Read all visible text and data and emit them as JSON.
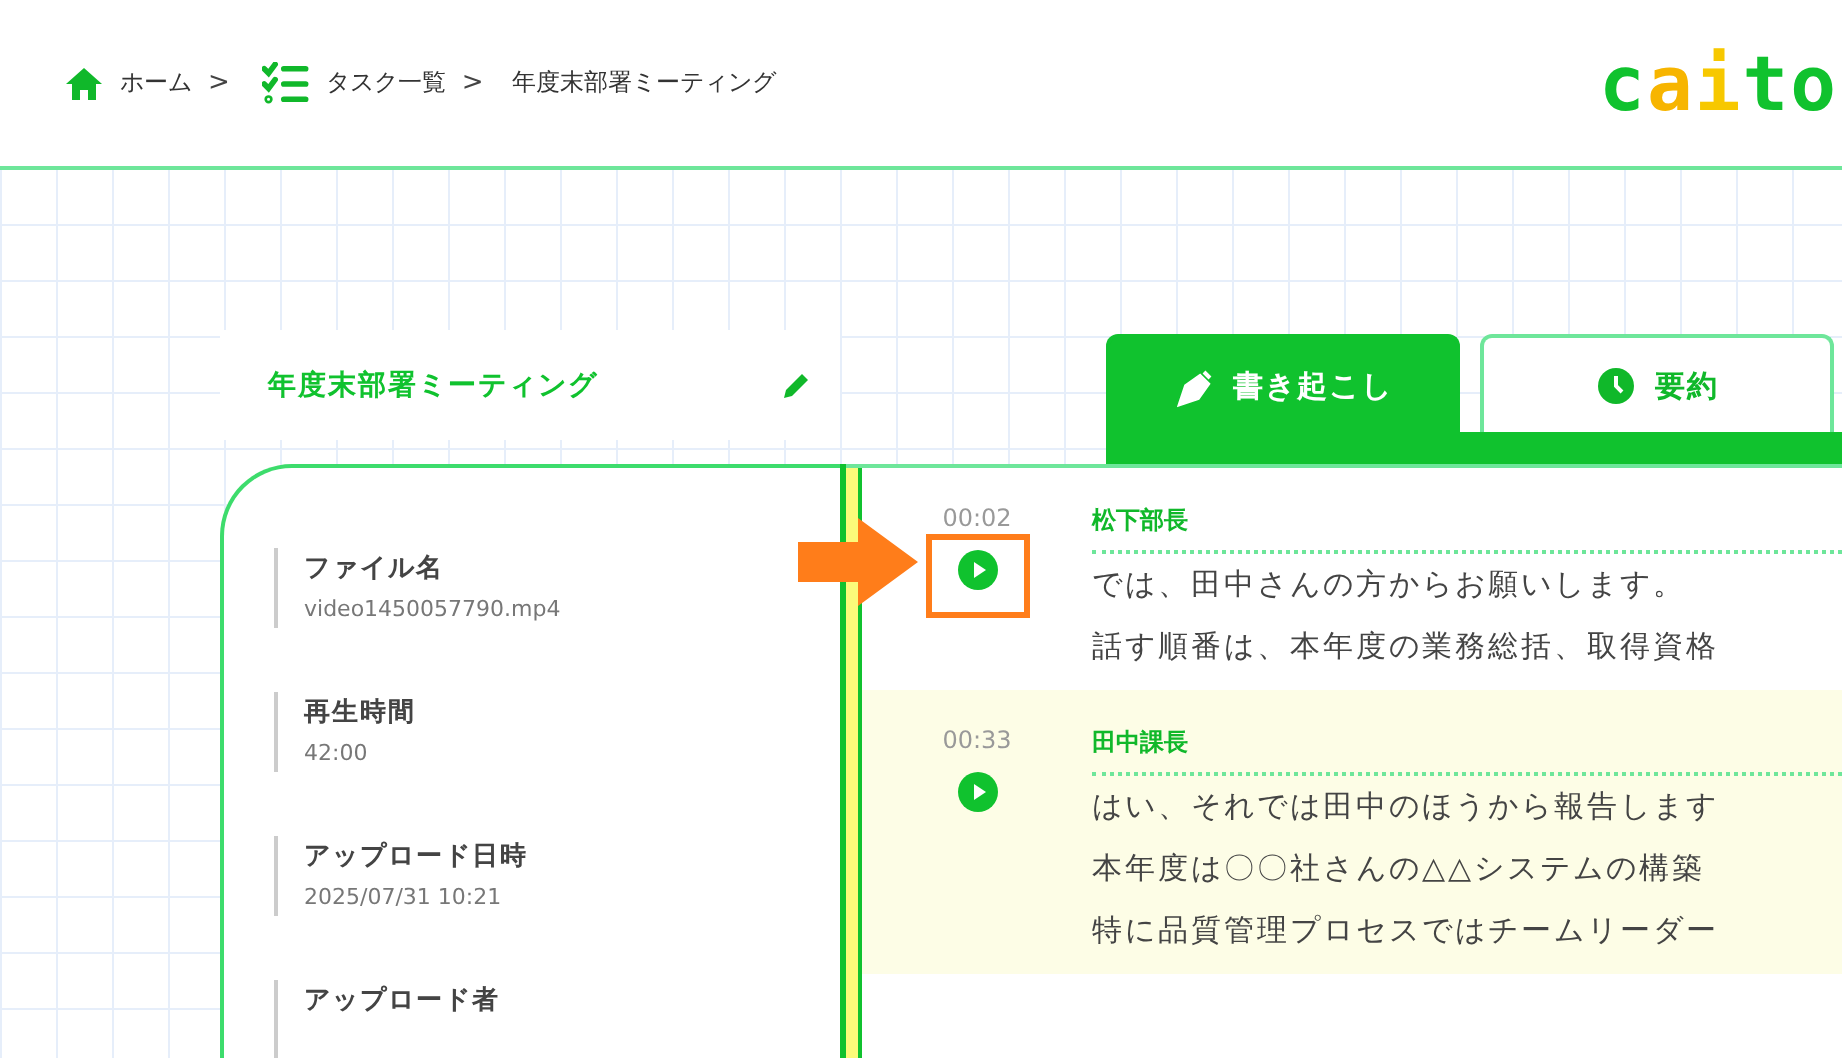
{
  "breadcrumbs": [
    {
      "label": "ホーム",
      "separator": ">"
    },
    {
      "label": "タスク一覧",
      "separator": ">"
    },
    {
      "label": "年度末部署ミーティング"
    }
  ],
  "logo": "caito",
  "title": "年度末部署ミーティング",
  "tabs": [
    {
      "label": "書き起こし",
      "selected": true
    },
    {
      "label": "要約",
      "selected": false
    }
  ],
  "file_info": [
    {
      "label": "ファイル名",
      "value": "video1450057790.mp4"
    },
    {
      "label": "再生時間",
      "value": "42:00"
    },
    {
      "label": "アップロード日時",
      "value": "2025/07/31 10:21"
    },
    {
      "label": "アップロード者"
    }
  ],
  "transcript": [
    {
      "time": "00:02",
      "speaker": "松下部長",
      "highlighted": false,
      "pointed": true,
      "lines": [
        "では、田中さんの方からお願いします。",
        "話す順番は、本年度の業務総括、取得資格"
      ]
    },
    {
      "time": "00:33",
      "speaker": "田中課長",
      "highlighted": true,
      "pointed": false,
      "lines": [
        "はい、それでは田中のほうから報告します",
        "本年度は〇〇社さんの△△システムの構築",
        "特に品質管理プロセスではチームリーダー"
      ]
    }
  ]
}
